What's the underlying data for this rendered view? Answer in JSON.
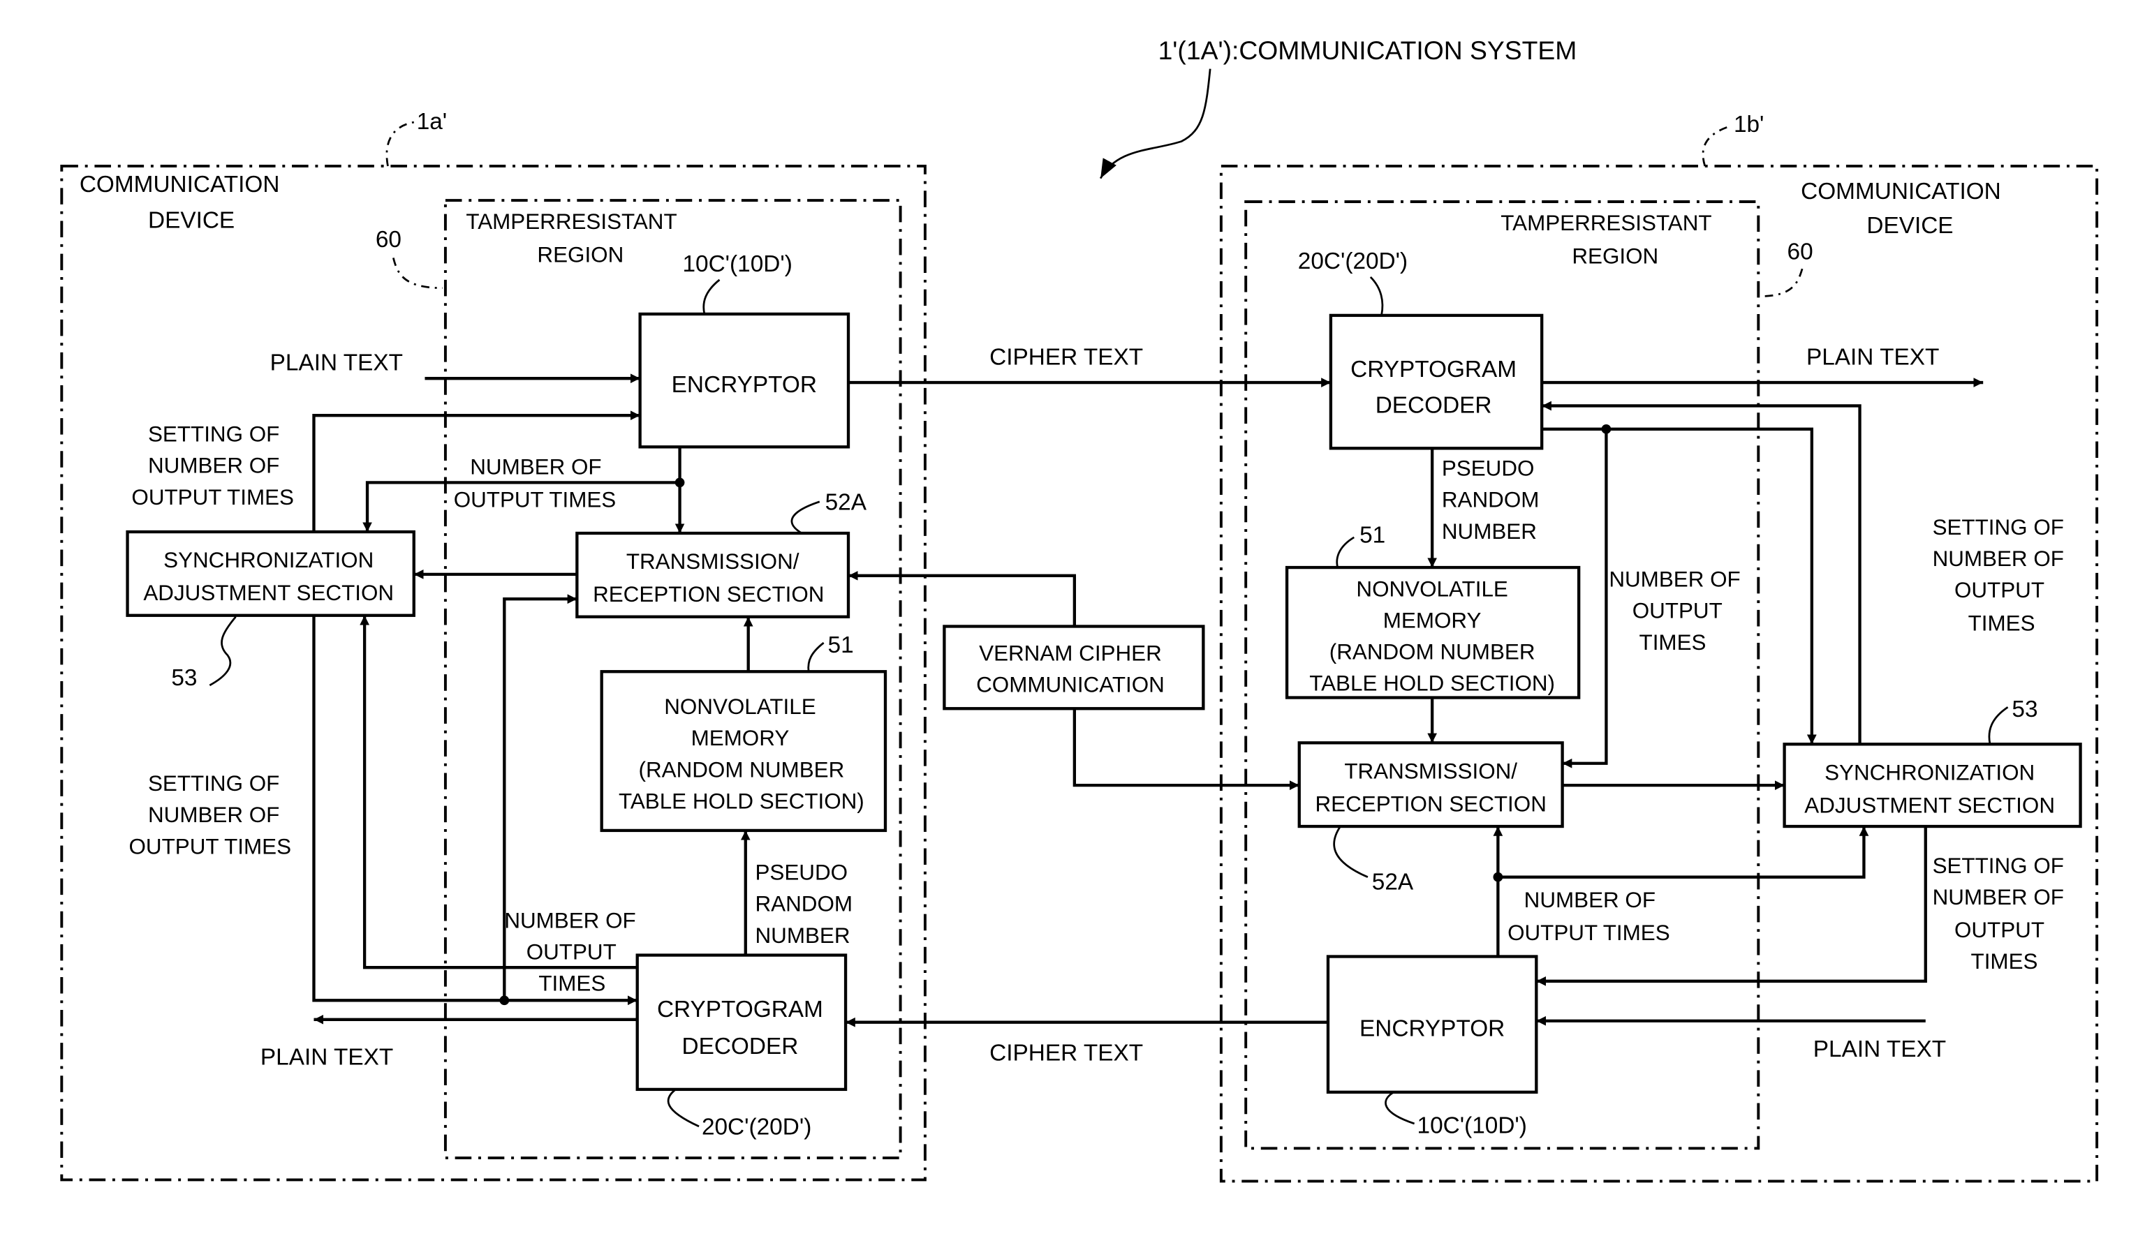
{
  "title": "1'(1A'):COMMUNICATION SYSTEM",
  "center": {
    "vernam": [
      "VERNAM CIPHER",
      "COMMUNICATION"
    ],
    "cipher_text_top": "CIPHER TEXT",
    "cipher_text_bottom": "CIPHER TEXT"
  },
  "left_device": {
    "ref": "1a'",
    "label": [
      "COMMUNICATION",
      "DEVICE"
    ],
    "region_ref": "60",
    "region_label": [
      "TAMPERRESISTANT",
      "REGION"
    ],
    "encryptor": {
      "ref": "10C'(10D')",
      "label": "ENCRYPTOR"
    },
    "transceiver": {
      "ref": "52A",
      "label": [
        "TRANSMISSION/",
        "RECEPTION SECTION"
      ]
    },
    "sync": {
      "ref": "53",
      "label": [
        "SYNCHRONIZATION",
        "ADJUSTMENT SECTION"
      ]
    },
    "memory": {
      "ref": "51",
      "label": [
        "NONVOLATILE",
        "MEMORY",
        "(RANDOM NUMBER",
        "TABLE HOLD SECTION)"
      ]
    },
    "decoder": {
      "ref": "20C'(20D')",
      "label": [
        "CRYPTOGRAM",
        "DECODER"
      ]
    },
    "plain_text_in": "PLAIN TEXT",
    "plain_text_out": "PLAIN TEXT",
    "setting_top": [
      "SETTING OF",
      "NUMBER OF",
      "OUTPUT TIMES"
    ],
    "setting_bottom": [
      "SETTING OF",
      "NUMBER OF",
      "OUTPUT TIMES"
    ],
    "num_output_top": [
      "NUMBER OF",
      "OUTPUT TIMES"
    ],
    "num_output_bottom": [
      "NUMBER OF",
      "OUTPUT",
      "TIMES"
    ],
    "pseudo_random": [
      "PSEUDO",
      "RANDOM",
      "NUMBER"
    ]
  },
  "right_device": {
    "ref": "1b'",
    "label": [
      "COMMUNICATION",
      "DEVICE"
    ],
    "region_ref": "60",
    "region_label": [
      "TAMPERRESISTANT",
      "REGION"
    ],
    "decoder": {
      "ref": "20C'(20D')",
      "label": [
        "CRYPTOGRAM",
        "DECODER"
      ]
    },
    "memory": {
      "ref": "51",
      "label": [
        "NONVOLATILE",
        "MEMORY",
        "(RANDOM NUMBER",
        "TABLE HOLD SECTION)"
      ]
    },
    "transceiver": {
      "ref": "52A",
      "label": [
        "TRANSMISSION/",
        "RECEPTION SECTION"
      ]
    },
    "sync": {
      "ref": "53",
      "label": [
        "SYNCHRONIZATION",
        "ADJUSTMENT SECTION"
      ]
    },
    "encryptor": {
      "ref": "10C'(10D')",
      "label": "ENCRYPTOR"
    },
    "plain_text_out": "PLAIN TEXT",
    "plain_text_in": "PLAIN TEXT",
    "pseudo_random": [
      "PSEUDO",
      "RANDOM",
      "NUMBER"
    ],
    "num_output_mid": [
      "NUMBER OF",
      "OUTPUT",
      "TIMES"
    ],
    "num_output_bottom": [
      "NUMBER OF",
      "OUTPUT TIMES"
    ],
    "setting_top": [
      "SETTING OF",
      "NUMBER OF",
      "OUTPUT",
      "TIMES"
    ],
    "setting_bottom": [
      "SETTING OF",
      "NUMBER OF",
      "OUTPUT",
      "TIMES"
    ]
  }
}
